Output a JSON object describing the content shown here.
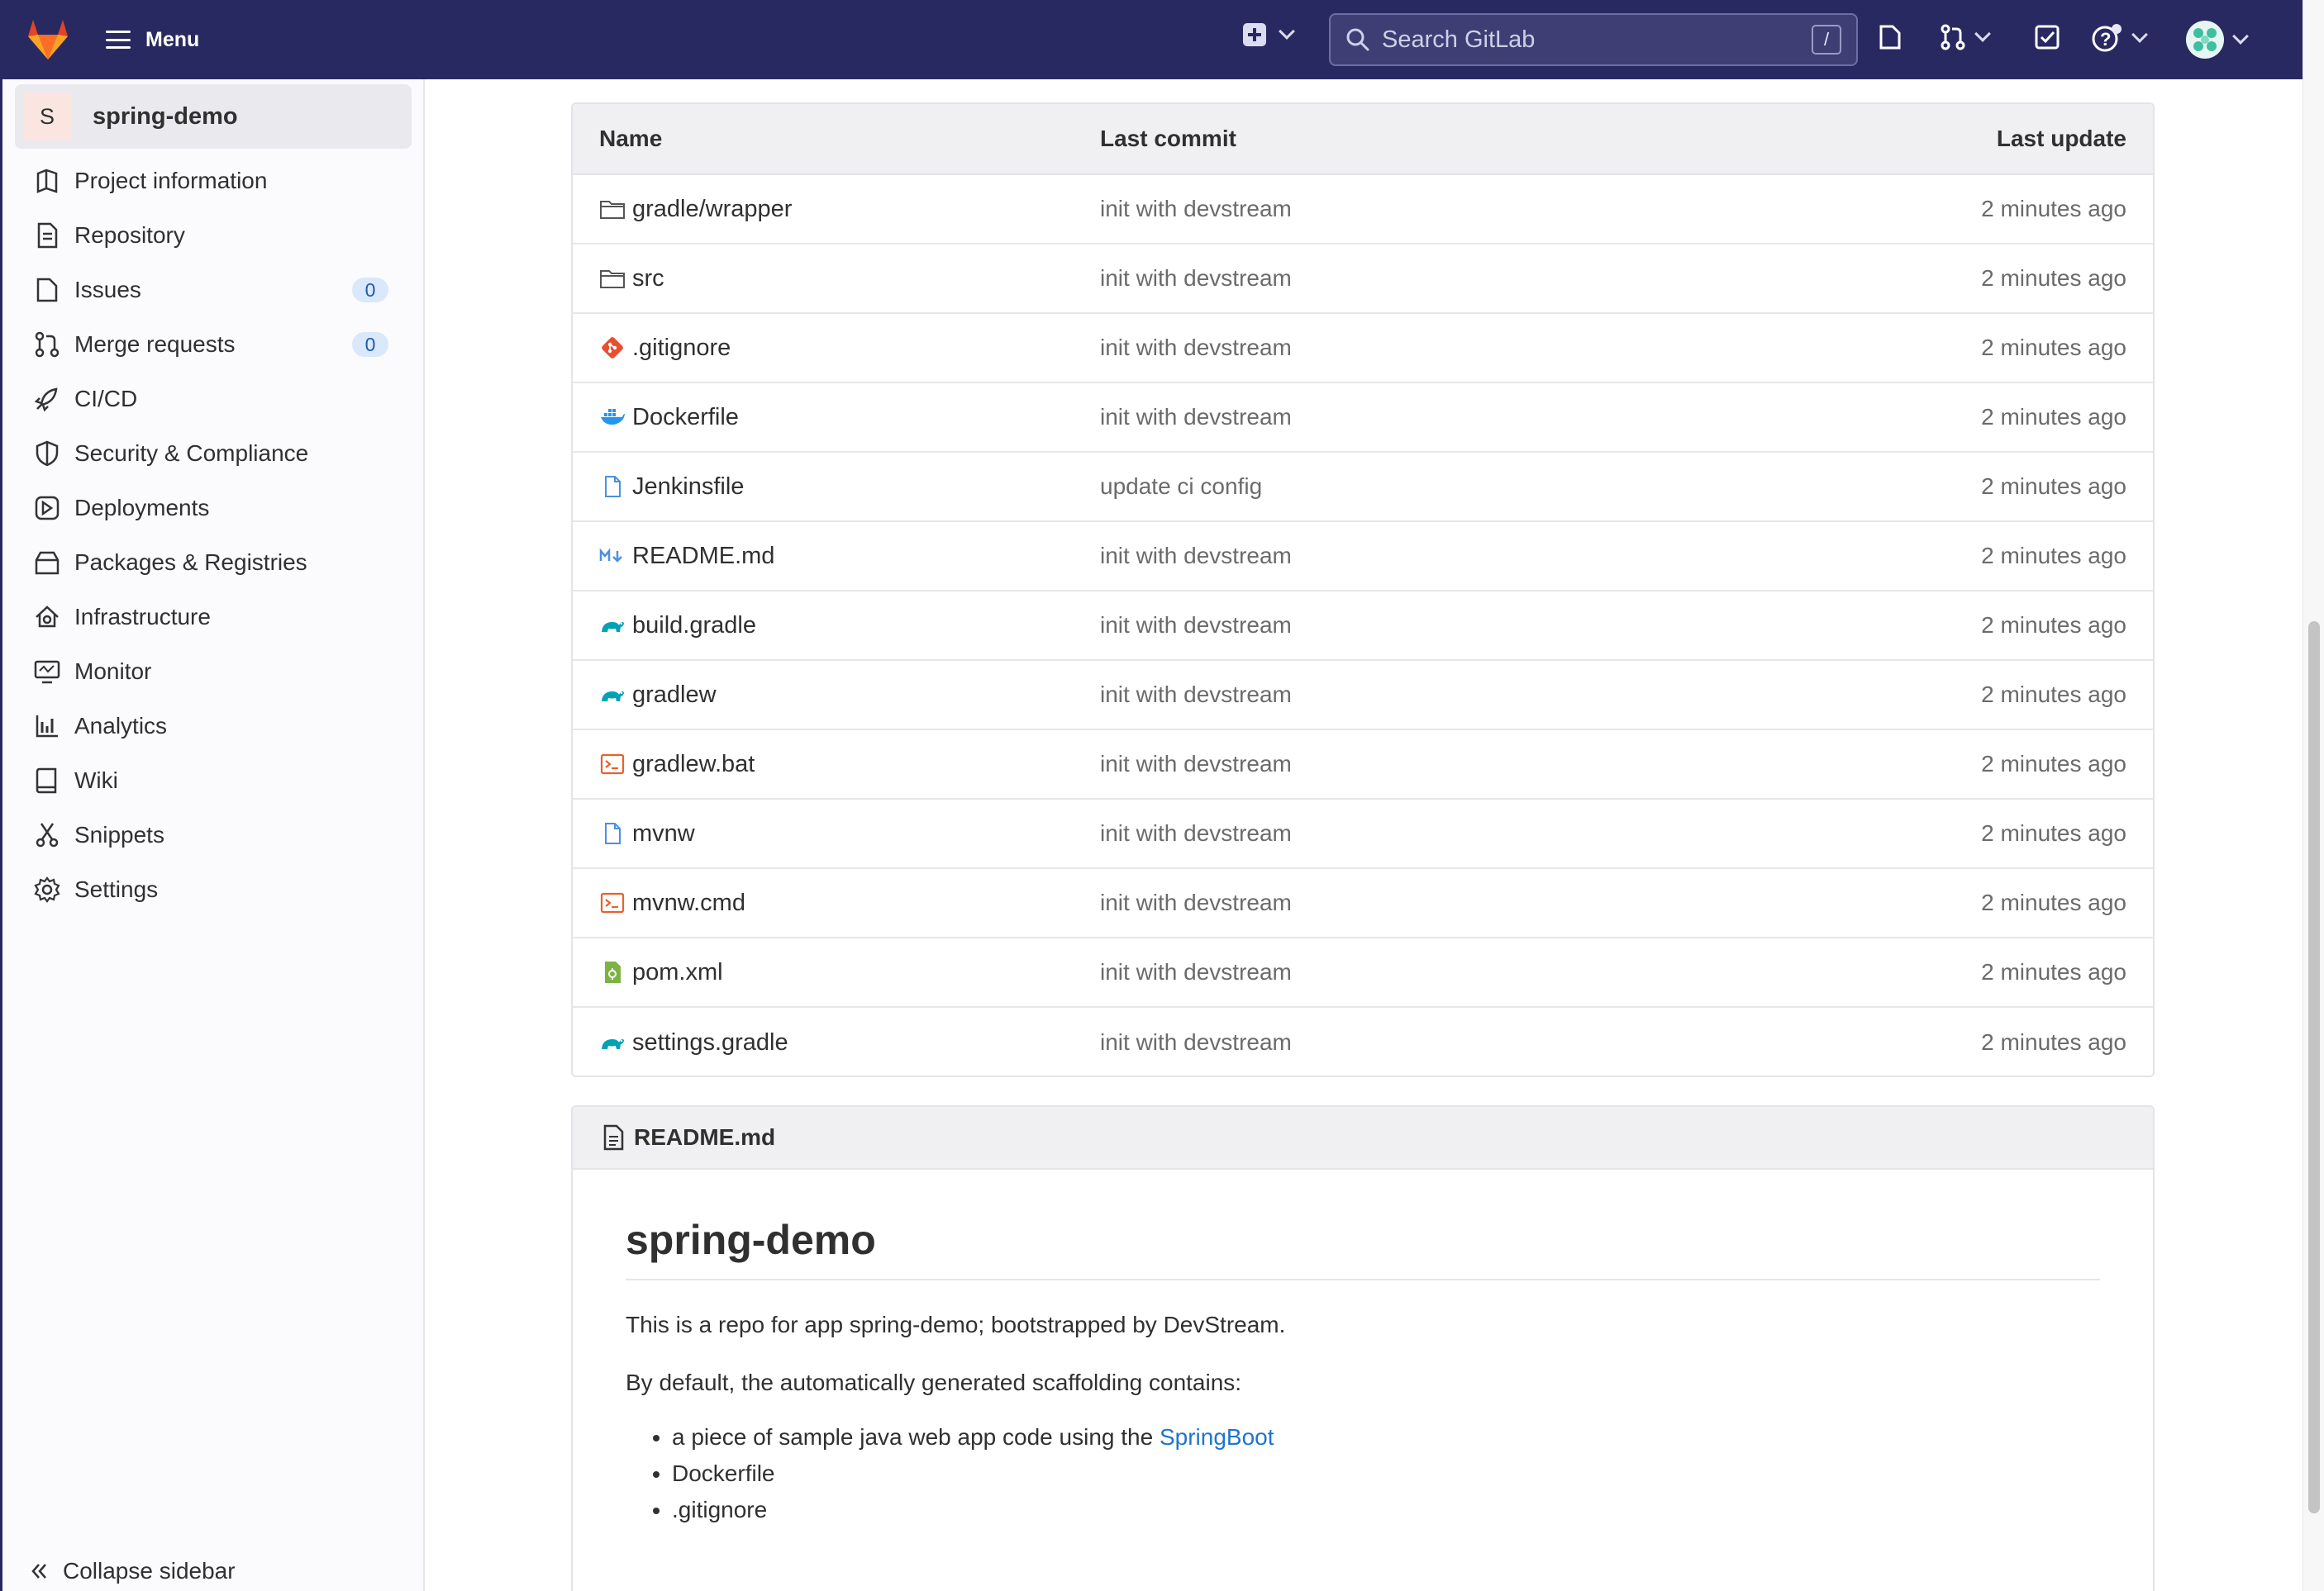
{
  "topbar": {
    "menu_label": "Menu",
    "search_placeholder": "Search GitLab",
    "search_shortcut": "/"
  },
  "sidebar": {
    "project_initial": "S",
    "project_name": "spring-demo",
    "items": [
      {
        "label": "Project information",
        "icon": "project-info-icon"
      },
      {
        "label": "Repository",
        "icon": "repository-icon"
      },
      {
        "label": "Issues",
        "icon": "issues-icon",
        "badge": "0"
      },
      {
        "label": "Merge requests",
        "icon": "merge-request-icon",
        "badge": "0"
      },
      {
        "label": "CI/CD",
        "icon": "rocket-icon"
      },
      {
        "label": "Security & Compliance",
        "icon": "shield-icon"
      },
      {
        "label": "Deployments",
        "icon": "deployments-icon"
      },
      {
        "label": "Packages & Registries",
        "icon": "package-icon"
      },
      {
        "label": "Infrastructure",
        "icon": "cloud-gear-icon"
      },
      {
        "label": "Monitor",
        "icon": "monitor-icon"
      },
      {
        "label": "Analytics",
        "icon": "analytics-icon"
      },
      {
        "label": "Wiki",
        "icon": "book-icon"
      },
      {
        "label": "Snippets",
        "icon": "scissors-icon"
      },
      {
        "label": "Settings",
        "icon": "gear-icon"
      }
    ],
    "collapse_label": "Collapse sidebar"
  },
  "file_table": {
    "headers": {
      "name": "Name",
      "commit": "Last commit",
      "update": "Last update"
    },
    "rows": [
      {
        "name": "gradle/wrapper",
        "commit": "init with devstream",
        "update": "2 minutes ago",
        "icon": "folder-icon"
      },
      {
        "name": "src",
        "commit": "init with devstream",
        "update": "2 minutes ago",
        "icon": "folder-icon"
      },
      {
        "name": ".gitignore",
        "commit": "init with devstream",
        "update": "2 minutes ago",
        "icon": "git-icon"
      },
      {
        "name": "Dockerfile",
        "commit": "init with devstream",
        "update": "2 minutes ago",
        "icon": "docker-icon"
      },
      {
        "name": "Jenkinsfile",
        "commit": "update ci config",
        "update": "2 minutes ago",
        "icon": "file-icon"
      },
      {
        "name": "README.md",
        "commit": "init with devstream",
        "update": "2 minutes ago",
        "icon": "markdown-icon"
      },
      {
        "name": "build.gradle",
        "commit": "init with devstream",
        "update": "2 minutes ago",
        "icon": "gradle-icon"
      },
      {
        "name": "gradlew",
        "commit": "init with devstream",
        "update": "2 minutes ago",
        "icon": "gradle-icon"
      },
      {
        "name": "gradlew.bat",
        "commit": "init with devstream",
        "update": "2 minutes ago",
        "icon": "terminal-icon"
      },
      {
        "name": "mvnw",
        "commit": "init with devstream",
        "update": "2 minutes ago",
        "icon": "file-icon"
      },
      {
        "name": "mvnw.cmd",
        "commit": "init with devstream",
        "update": "2 minutes ago",
        "icon": "terminal-icon"
      },
      {
        "name": "pom.xml",
        "commit": "init with devstream",
        "update": "2 minutes ago",
        "icon": "xml-icon"
      },
      {
        "name": "settings.gradle",
        "commit": "init with devstream",
        "update": "2 minutes ago",
        "icon": "gradle-icon"
      }
    ]
  },
  "readme": {
    "filename": "README.md",
    "title": "spring-demo",
    "paragraph1": "This is a repo for app spring-demo; bootstrapped by DevStream.",
    "paragraph2": "By default, the automatically generated scaffolding contains:",
    "list_item1_prefix": "a piece of sample java web app code using the ",
    "list_item1_link": "SpringBoot",
    "list_item2": "Dockerfile",
    "list_item3": ".gitignore"
  },
  "colors": {
    "topbar_bg": "#292961",
    "link": "#1f75cb",
    "badge_bg": "#d9e8fb",
    "project_avatar_bg": "#fbe5e1"
  }
}
